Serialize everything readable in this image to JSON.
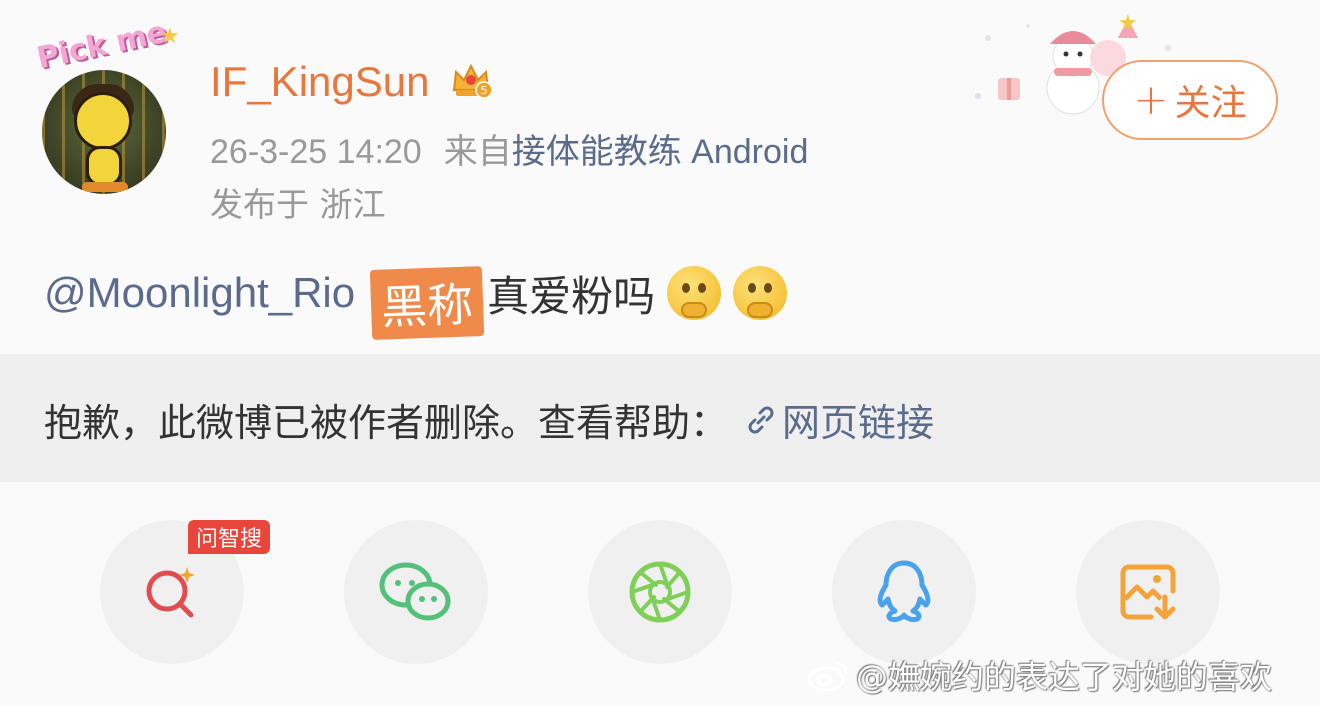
{
  "post": {
    "avatar_caption": "Pick me",
    "username": "IF_KingSun",
    "badge_icon": "crown-vip-icon",
    "badge_level": "5",
    "timestamp": "26-3-25 14:20",
    "source_prefix": "来自",
    "source_name": "接体能教练 Android",
    "location": "发布于 浙江",
    "follow_label": "关注",
    "content": {
      "mention": "@Moonlight_Rio",
      "sticker": "黑称",
      "text": "真爱粉吗",
      "emoji_count": 2
    }
  },
  "deleted_notice": {
    "text": "抱歉，此微博已被作者删除。查看帮助：",
    "link_label": "网页链接"
  },
  "share_bar": {
    "badge": "问智搜",
    "items": [
      {
        "name": "ai-search",
        "icon": "search-sparkle-icon",
        "color": "#e24b50"
      },
      {
        "name": "wechat",
        "icon": "wechat-icon",
        "color": "#53c17a"
      },
      {
        "name": "moments",
        "icon": "aperture-icon",
        "color": "#7fcf59"
      },
      {
        "name": "qq",
        "icon": "qq-penguin-icon",
        "color": "#4aa3ea"
      },
      {
        "name": "save-image",
        "icon": "save-image-icon",
        "color": "#f2a43a"
      }
    ]
  },
  "watermark": "@嫵婉约的表达了对她的喜欢",
  "colors": {
    "accent": "#e8773e",
    "link": "#5a6b8c",
    "meta": "#999999"
  }
}
